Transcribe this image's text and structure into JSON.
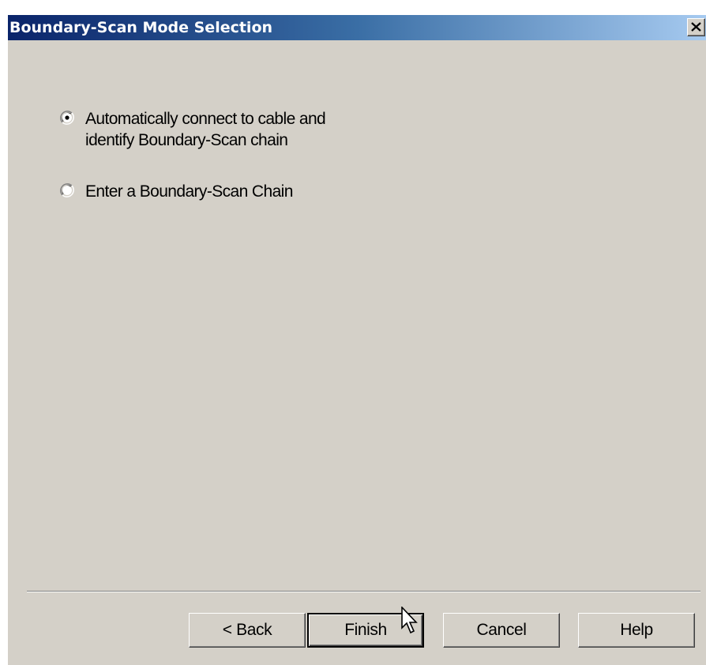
{
  "window": {
    "title": "Boundary-Scan Mode Selection",
    "close_icon": "close-icon"
  },
  "options": [
    {
      "label": "Automatically connect to cable and\nidentify Boundary-Scan chain",
      "selected": true
    },
    {
      "label": "Enter a Boundary-Scan Chain",
      "selected": false
    }
  ],
  "buttons": {
    "back": "< Back",
    "finish": "Finish",
    "cancel": "Cancel",
    "help": "Help"
  },
  "colors": {
    "dialog_bg": "#d4d0c8",
    "titlebar_start": "#0a246a",
    "titlebar_end": "#a6caf0"
  }
}
